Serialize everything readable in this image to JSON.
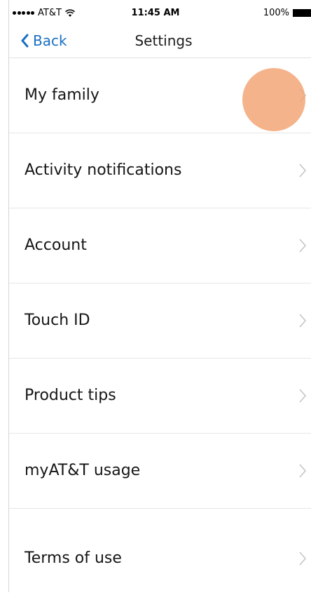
{
  "status_bar": {
    "carrier": "AT&T",
    "time": "11:45 AM",
    "battery": "100%"
  },
  "nav": {
    "back_label": "Back",
    "title": "Settings"
  },
  "settings": {
    "items": [
      {
        "label": "My family"
      },
      {
        "label": "Activity notifications"
      },
      {
        "label": "Account"
      },
      {
        "label": "Touch ID"
      },
      {
        "label": "Product tips"
      },
      {
        "label": "myAT&T usage"
      },
      {
        "label": "Terms of use"
      }
    ]
  },
  "colors": {
    "accent": "#1a6fc4",
    "touch_indicator": "#f3a06e"
  },
  "icons": {
    "back": "chevron-left-icon",
    "row": "chevron-right-icon",
    "wifi": "wifi-icon",
    "battery": "battery-icon"
  }
}
